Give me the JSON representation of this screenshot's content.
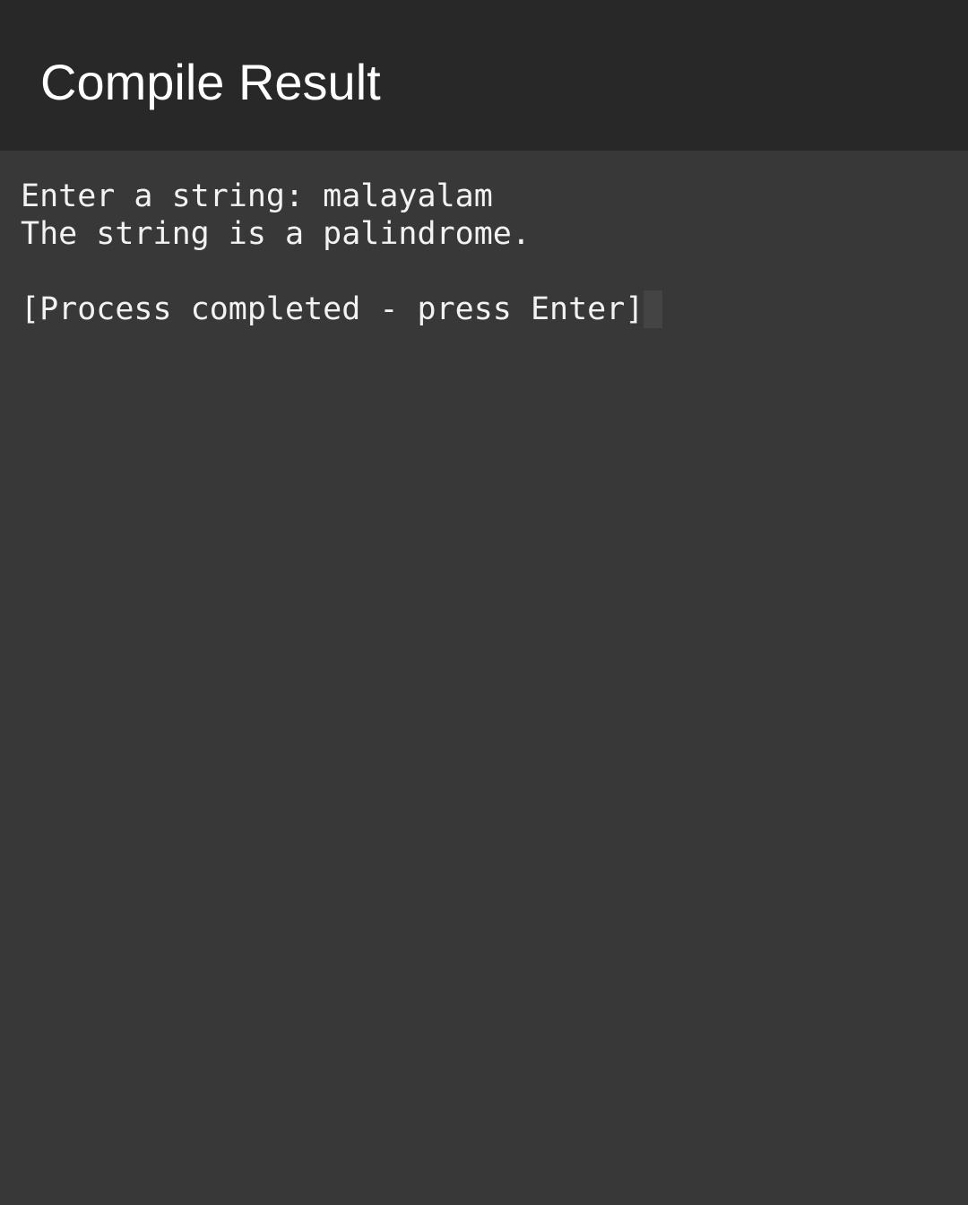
{
  "app_bar": {
    "title": "Compile Result"
  },
  "terminal": {
    "lines": [
      "Enter a string: malayalam",
      "The string is a palindrome.",
      "",
      "[Process completed - press Enter]"
    ]
  },
  "colors": {
    "app_bar_bg": "#282828",
    "terminal_bg": "#383838",
    "text": "#f2f2f2",
    "cursor": "#444444"
  }
}
